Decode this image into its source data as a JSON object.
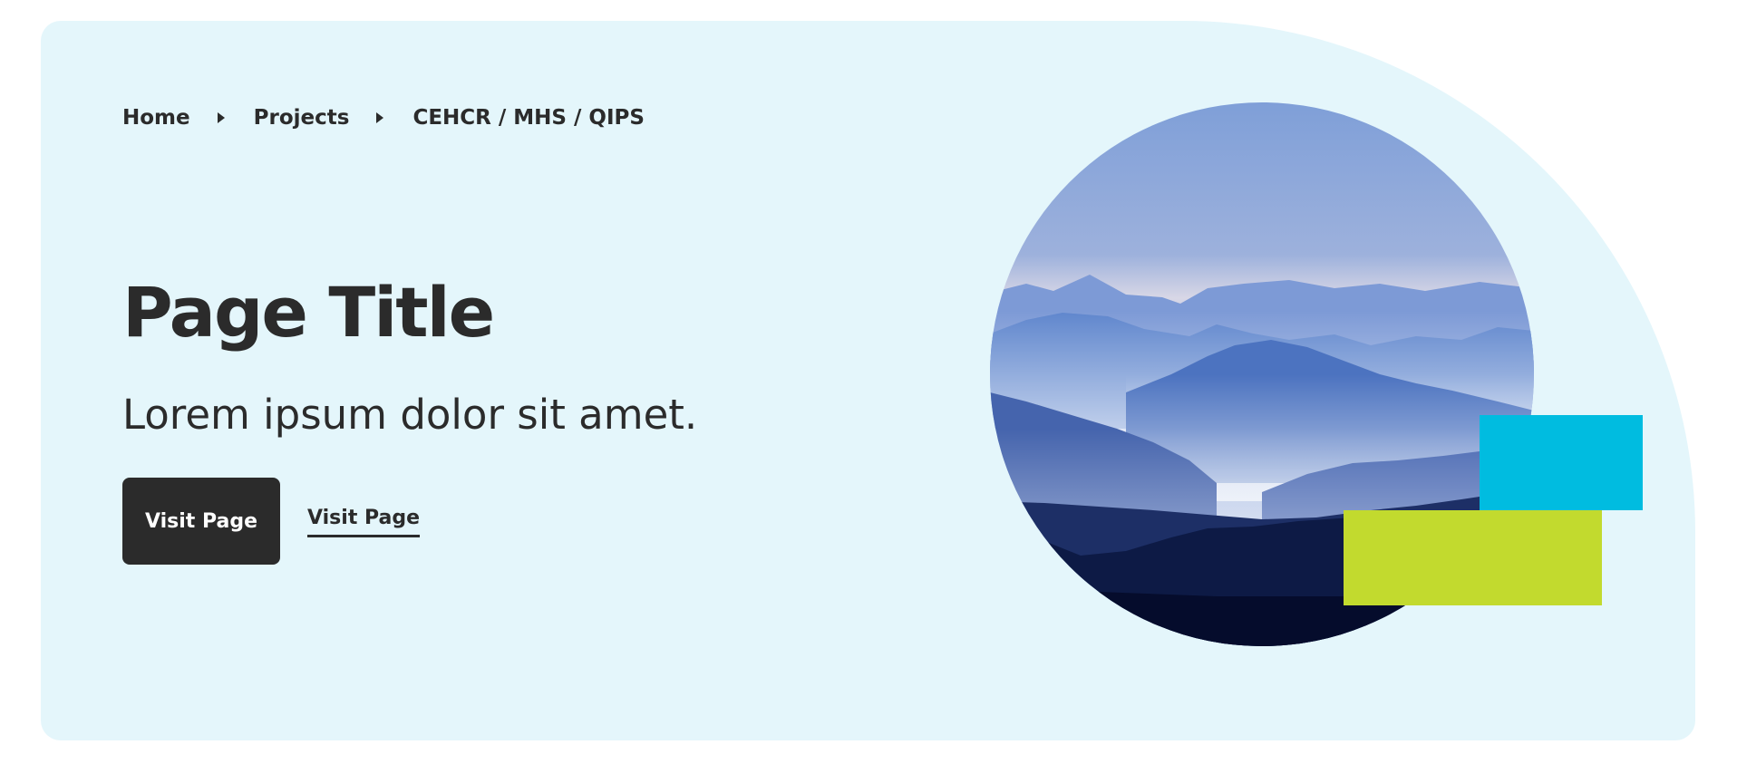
{
  "breadcrumb": {
    "items": [
      "Home",
      "Projects",
      "CEHCR / MHS / QIPS"
    ]
  },
  "hero": {
    "title": "Page Title",
    "subtitle": "Lorem ipsum dolor sit amet.",
    "primary_button_label": "Visit Page",
    "secondary_link_label": "Visit Page",
    "image_alt": "misty blue mountain ranges"
  },
  "colors": {
    "background": "#e4f6fb",
    "text": "#2b2b2b",
    "accent_cyan": "#00bce0",
    "accent_lime": "#c2da2e"
  }
}
